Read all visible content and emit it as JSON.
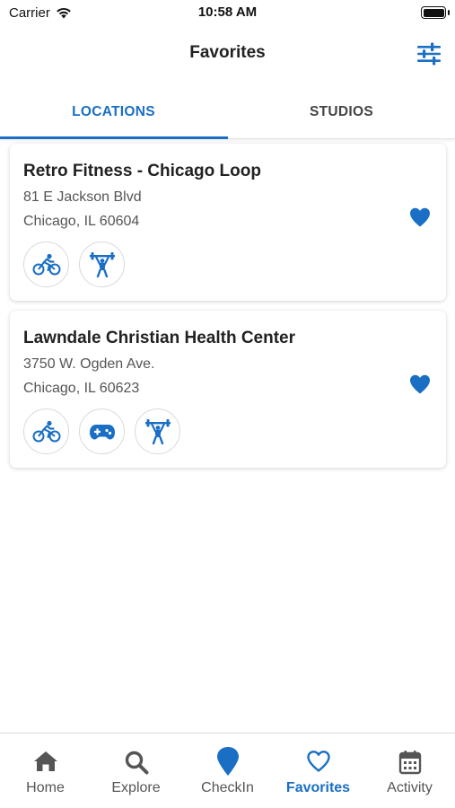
{
  "status_bar": {
    "carrier": "Carrier",
    "time": "10:58 AM"
  },
  "nav": {
    "title": "Favorites"
  },
  "tabs": [
    {
      "label": "LOCATIONS",
      "active": true
    },
    {
      "label": "STUDIOS",
      "active": false
    }
  ],
  "favorites": [
    {
      "name": "Retro Fitness - Chicago Loop",
      "address": "81 E Jackson Blvd",
      "city": "Chicago, IL 60604",
      "favorited": true,
      "amenities": [
        "cycling-icon",
        "weightlifting-icon"
      ]
    },
    {
      "name": "Lawndale Christian Health Center",
      "address": "3750 W. Ogden Ave.",
      "city": "Chicago, IL 60623",
      "favorited": true,
      "amenities": [
        "cycling-icon",
        "gamepad-icon",
        "weightlifting-icon"
      ]
    }
  ],
  "bottom_nav": [
    {
      "label": "Home",
      "icon": "home-icon"
    },
    {
      "label": "Explore",
      "icon": "search-icon"
    },
    {
      "label": "CheckIn",
      "icon": "location-pin-icon"
    },
    {
      "label": "Favorites",
      "icon": "heart-outline-icon",
      "active": true
    },
    {
      "label": "Activity",
      "icon": "calendar-icon"
    }
  ],
  "colors": {
    "accent": "#1a6fc4",
    "text": "#222222",
    "muted": "#555555"
  }
}
